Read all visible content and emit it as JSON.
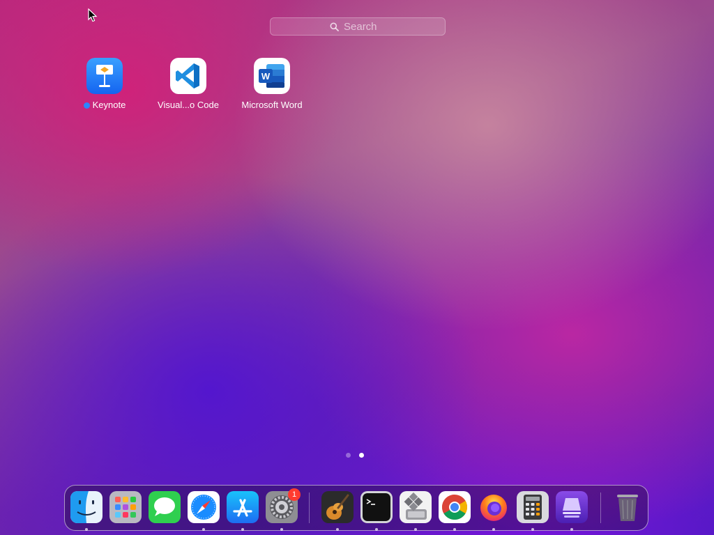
{
  "search": {
    "placeholder": "Search"
  },
  "apps": [
    {
      "label": "Keynote"
    },
    {
      "label": "Visual...o Code"
    },
    {
      "label": "Microsoft Word"
    }
  ],
  "page_indicator": {
    "pages": 2,
    "current": 2
  },
  "dock": {
    "items": [
      {
        "name": "Finder",
        "icon": "finder-icon"
      },
      {
        "name": "Launchpad",
        "icon": "launchpad-icon"
      },
      {
        "name": "Messages",
        "icon": "messages-icon"
      },
      {
        "name": "Safari",
        "icon": "safari-icon"
      },
      {
        "name": "App Store",
        "icon": "app-store-icon"
      },
      {
        "name": "System Preferences",
        "icon": "gear-icon",
        "badge": "1"
      },
      {
        "name": "GarageBand",
        "icon": "guitar-icon"
      },
      {
        "name": "Terminal",
        "icon": "terminal-icon"
      },
      {
        "name": "Boot Camp Assistant",
        "icon": "boot-camp-icon"
      },
      {
        "name": "Chrome",
        "icon": "chrome-icon"
      },
      {
        "name": "Firefox",
        "icon": "firefox-icon"
      },
      {
        "name": "Calculator",
        "icon": "calculator-icon"
      },
      {
        "name": "Apple Configurator",
        "icon": "configurator-icon"
      },
      {
        "name": "Trash",
        "icon": "trash-icon"
      }
    ]
  },
  "colors": {
    "accent_dot": "#2a86ff",
    "badge": "#ff3b30"
  }
}
